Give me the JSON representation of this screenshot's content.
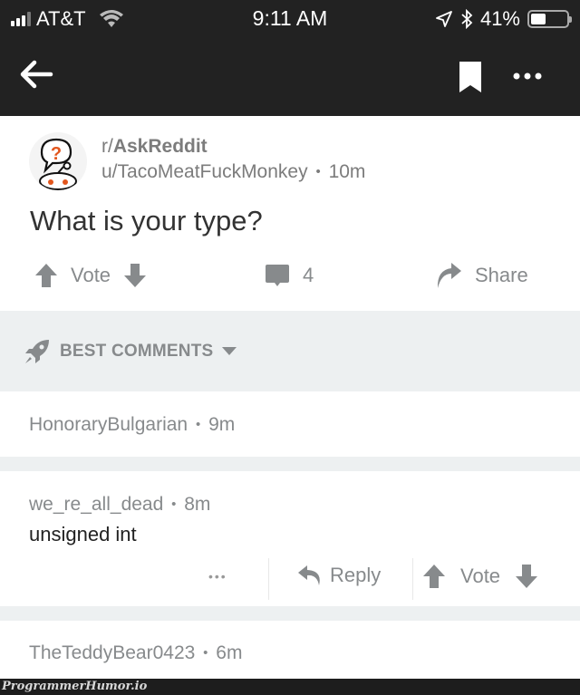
{
  "status_bar": {
    "carrier": "AT&T",
    "time": "9:11 AM",
    "battery_percent": "41%",
    "battery_level": 0.41
  },
  "navbar": {
    "back_icon": "arrow-left-icon",
    "bookmark_icon": "bookmark-icon",
    "more_icon": "more-horizontal-icon"
  },
  "post": {
    "subreddit_prefix": "r/",
    "subreddit": "AskReddit",
    "author": "u/TacoMeatFuckMonkey",
    "separator": "•",
    "age": "10m",
    "title": "What is your type?",
    "vote_label": "Vote",
    "comment_count": "4",
    "share_label": "Share"
  },
  "sort": {
    "label": "BEST COMMENTS",
    "icon": "rocket-icon"
  },
  "comments": [
    {
      "author": "HonoraryBulgarian",
      "separator": "•",
      "age": "9m",
      "body": ""
    },
    {
      "author": "we_re_all_dead",
      "separator": "•",
      "age": "8m",
      "body": "unsigned int",
      "actions": {
        "more": "•••",
        "reply": "Reply",
        "vote": "Vote"
      }
    },
    {
      "author": "TheTeddyBear0423",
      "separator": "•",
      "age": "6m",
      "body": ""
    }
  ],
  "watermark": "ProgrammerHumor.io",
  "colors": {
    "topbar": "#222222",
    "icon_gray": "#878a8c",
    "divider": "#edf0f1",
    "avatar_accent": "#e2561d"
  }
}
